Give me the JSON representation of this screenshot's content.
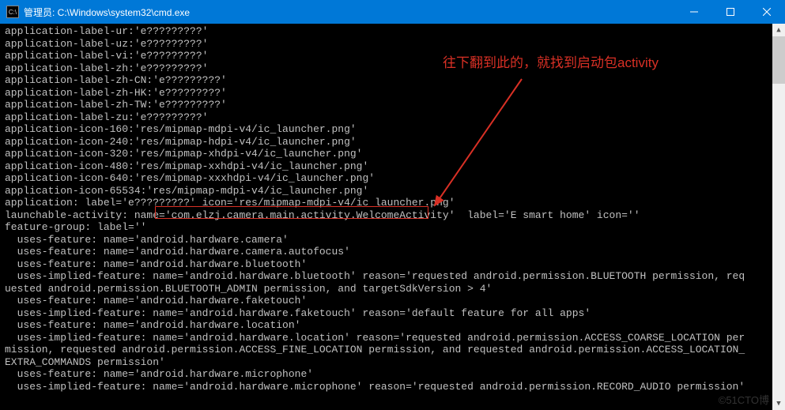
{
  "titlebar": {
    "icon_label": "C:\\",
    "title": "管理员: C:\\Windows\\system32\\cmd.exe"
  },
  "annotation": {
    "text": "往下翻到此的，就找到启动包activity"
  },
  "terminal": {
    "lines": [
      "application-label-ur:'e?????????'",
      "application-label-uz:'e?????????'",
      "application-label-vi:'e?????????'",
      "application-label-zh:'e?????????'",
      "application-label-zh-CN:'e?????????'",
      "application-label-zh-HK:'e?????????'",
      "application-label-zh-TW:'e?????????'",
      "application-label-zu:'e?????????'",
      "application-icon-160:'res/mipmap-mdpi-v4/ic_launcher.png'",
      "application-icon-240:'res/mipmap-hdpi-v4/ic_launcher.png'",
      "application-icon-320:'res/mipmap-xhdpi-v4/ic_launcher.png'",
      "application-icon-480:'res/mipmap-xxhdpi-v4/ic_launcher.png'",
      "application-icon-640:'res/mipmap-xxxhdpi-v4/ic_launcher.png'",
      "application-icon-65534:'res/mipmap-mdpi-v4/ic_launcher.png'",
      "application: label='e?????????' icon='res/mipmap-mdpi-v4/ic_launcher.png'",
      "launchable-activity: name='com.elzj.camera.main.activity.WelcomeActivity'  label='E smart home' icon=''",
      "feature-group: label=''",
      "  uses-feature: name='android.hardware.camera'",
      "  uses-feature: name='android.hardware.camera.autofocus'",
      "  uses-feature: name='android.hardware.bluetooth'",
      "  uses-implied-feature: name='android.hardware.bluetooth' reason='requested android.permission.BLUETOOTH permission, req",
      "uested android.permission.BLUETOOTH_ADMIN permission, and targetSdkVersion > 4'",
      "  uses-feature: name='android.hardware.faketouch'",
      "  uses-implied-feature: name='android.hardware.faketouch' reason='default feature for all apps'",
      "  uses-feature: name='android.hardware.location'",
      "  uses-implied-feature: name='android.hardware.location' reason='requested android.permission.ACCESS_COARSE_LOCATION per",
      "mission, requested android.permission.ACCESS_FINE_LOCATION permission, and requested android.permission.ACCESS_LOCATION_",
      "EXTRA_COMMANDS permission'",
      "  uses-feature: name='android.hardware.microphone'",
      "  uses-implied-feature: name='android.hardware.microphone' reason='requested android.permission.RECORD_AUDIO permission'"
    ]
  },
  "watermark": "©51CTO博"
}
